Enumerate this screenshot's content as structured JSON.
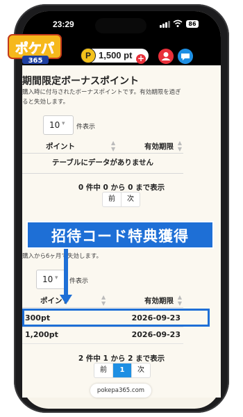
{
  "status_bar": {
    "time": "23:29",
    "battery": "86"
  },
  "header": {
    "logo_alt": "ポケパ365",
    "points_coin": "P",
    "points": "1,500 pt",
    "plus": "+"
  },
  "limited_bonus": {
    "title": "期間限定ボーナスポイント",
    "description": "購入時に付与されたボーナスポイントです。有効期限を過ぎると失効します。",
    "page_size": "10",
    "page_size_suffix": "件表示",
    "columns": [
      "ポイント",
      "有効期限"
    ],
    "empty_message": "テーブルにデータがありません",
    "info": "0 件中 0 から 0 まで表示",
    "prev": "前",
    "next": "次"
  },
  "invite_bonus": {
    "banner": "招待コード特典獲得",
    "description": "購入から6ヶ月で失効します。",
    "page_size": "10",
    "page_size_suffix": "件表示",
    "columns": [
      "ポイント",
      "有効期限"
    ],
    "rows": [
      {
        "points": "300pt",
        "expiry": "2026-09-23"
      },
      {
        "points": "1,200pt",
        "expiry": "2026-09-23"
      }
    ],
    "info": "2 件中 1 から 2 まで表示",
    "prev": "前",
    "current_page": "1",
    "next": "次"
  },
  "url_bar": {
    "domain": "pokepa365.com"
  }
}
